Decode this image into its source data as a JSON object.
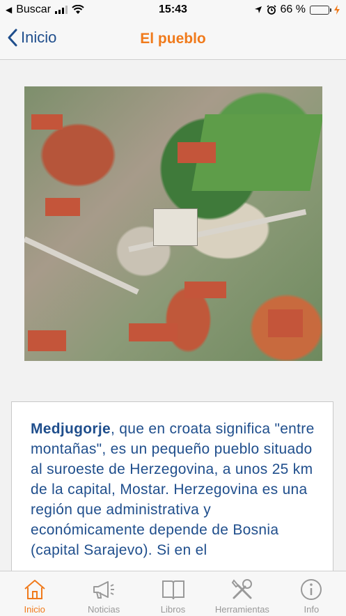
{
  "status_bar": {
    "carrier": "Buscar",
    "time": "15:43",
    "battery_percent": "66 %",
    "battery_level": 0.66
  },
  "nav": {
    "back_label": "Inicio",
    "title": "El pueblo"
  },
  "article": {
    "lead_bold": "Medjugorje",
    "lead_rest": ", que en croata significa \"entre montañas\", es un pequeño pueblo situado al suroeste de Herzegovina, a unos 25 km de la capital, Mostar. Herzegovina es una región que administrativa y económicamente depende de Bosnia (capital Sarajevo). Si en el"
  },
  "tabs": [
    {
      "label": "Inicio",
      "icon": "house-icon",
      "active": true
    },
    {
      "label": "Noticias",
      "icon": "megaphone-icon",
      "active": false
    },
    {
      "label": "Libros",
      "icon": "book-icon",
      "active": false
    },
    {
      "label": "Herramientas",
      "icon": "tools-icon",
      "active": false
    },
    {
      "label": "Info",
      "icon": "info-icon",
      "active": false
    }
  ],
  "colors": {
    "accent": "#f07a1b",
    "text_blue": "#1f4e8c",
    "inactive": "#999999"
  }
}
